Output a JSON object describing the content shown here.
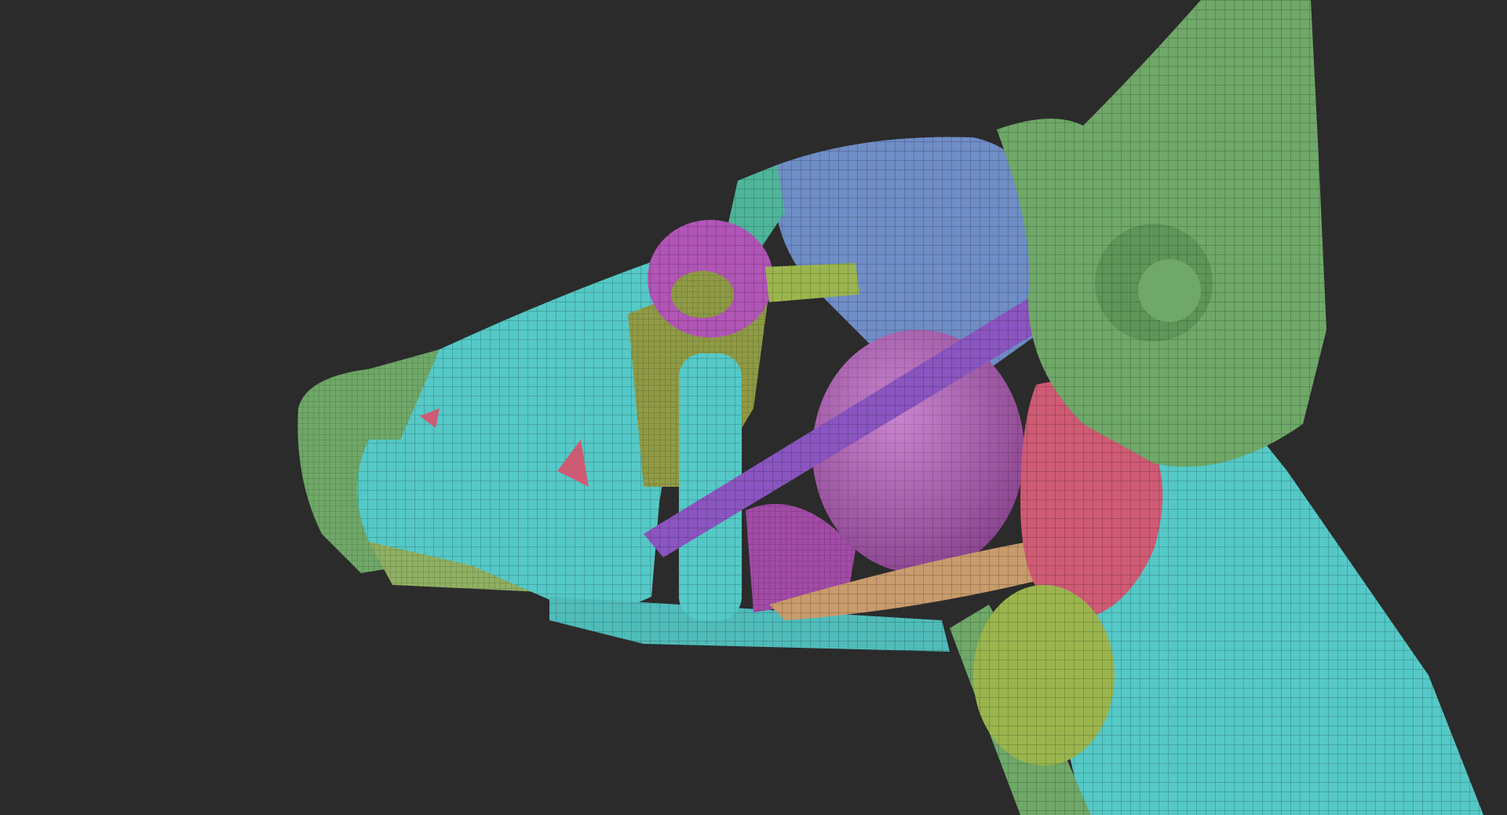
{
  "scene": {
    "background": "#2b2b2b",
    "subject": "dog-head-anatomy-sculpt",
    "palette": {
      "green": "#6fa868",
      "lime": "#9bb54e",
      "cyan": "#55c9c7",
      "blue": "#6f8dc6",
      "magenta": "#b85bbf",
      "purple": "#8a55c0",
      "red": "#cf5a74",
      "orange": "#c99b6d",
      "olive": "#8f9a45"
    }
  }
}
